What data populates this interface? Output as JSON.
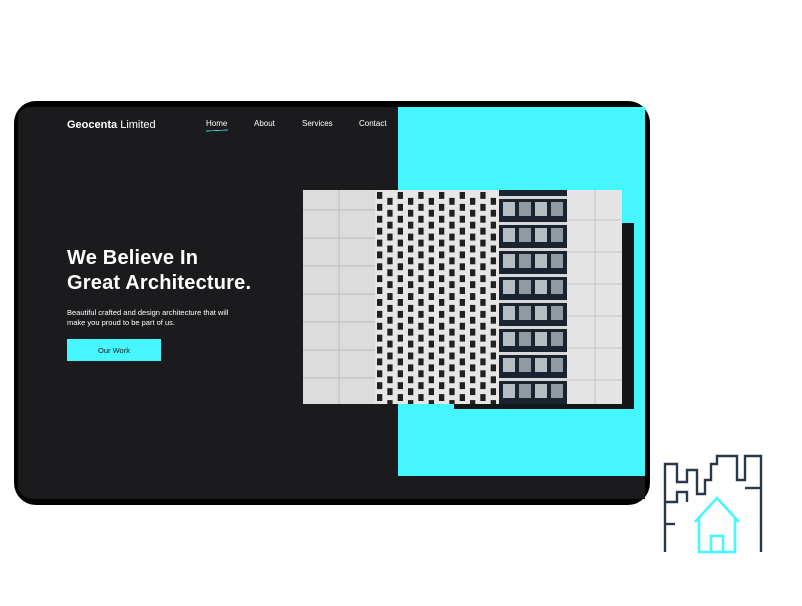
{
  "brand": {
    "bold": "Geocenta",
    "light": "Limited"
  },
  "nav": {
    "items": [
      {
        "label": "Home",
        "active": true
      },
      {
        "label": "About",
        "active": false
      },
      {
        "label": "Services",
        "active": false
      },
      {
        "label": "Contact",
        "active": false
      }
    ]
  },
  "hero": {
    "title_line1": "We Believe In",
    "title_line2": "Great Architecture.",
    "subtitle_line1": "Beautiful crafted and design architecture that will",
    "subtitle_line2": "make you proud to be part of us.",
    "cta_label": "Our Work"
  },
  "icons": {
    "hero_image": "building-facade-photo",
    "side_icon": "city-house-icon"
  },
  "colors": {
    "accent": "#46f6fe",
    "background": "#1b1b1d",
    "frame": "#000000",
    "icon_dark": "#27394a"
  }
}
